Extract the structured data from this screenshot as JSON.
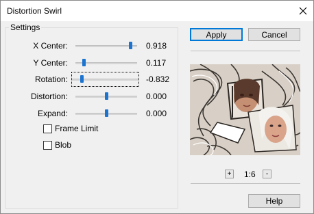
{
  "window": {
    "title": "Distortion Swirl"
  },
  "settings": {
    "group_label": "Settings",
    "sliders": [
      {
        "label": "X Center:",
        "value_text": "0.918",
        "position": 0.918
      },
      {
        "label": "Y Center:",
        "value_text": "0.117",
        "position": 0.117
      },
      {
        "label": "Rotation:",
        "value_text": "-0.832",
        "position": 0.084
      },
      {
        "label": "Distortion:",
        "value_text": "0.000",
        "position": 0.5
      },
      {
        "label": "Expand:",
        "value_text": "0.000",
        "position": 0.5
      }
    ],
    "checkboxes": [
      {
        "label": "Frame Limit",
        "checked": false
      },
      {
        "label": "Blob",
        "checked": false
      }
    ]
  },
  "buttons": {
    "apply": "Apply",
    "cancel": "Cancel",
    "help": "Help"
  },
  "zoom": {
    "plus": "+",
    "minus": "-",
    "level": "1:6"
  },
  "colors": {
    "accent": "#0078d7",
    "slider_thumb": "#1b74d0"
  }
}
